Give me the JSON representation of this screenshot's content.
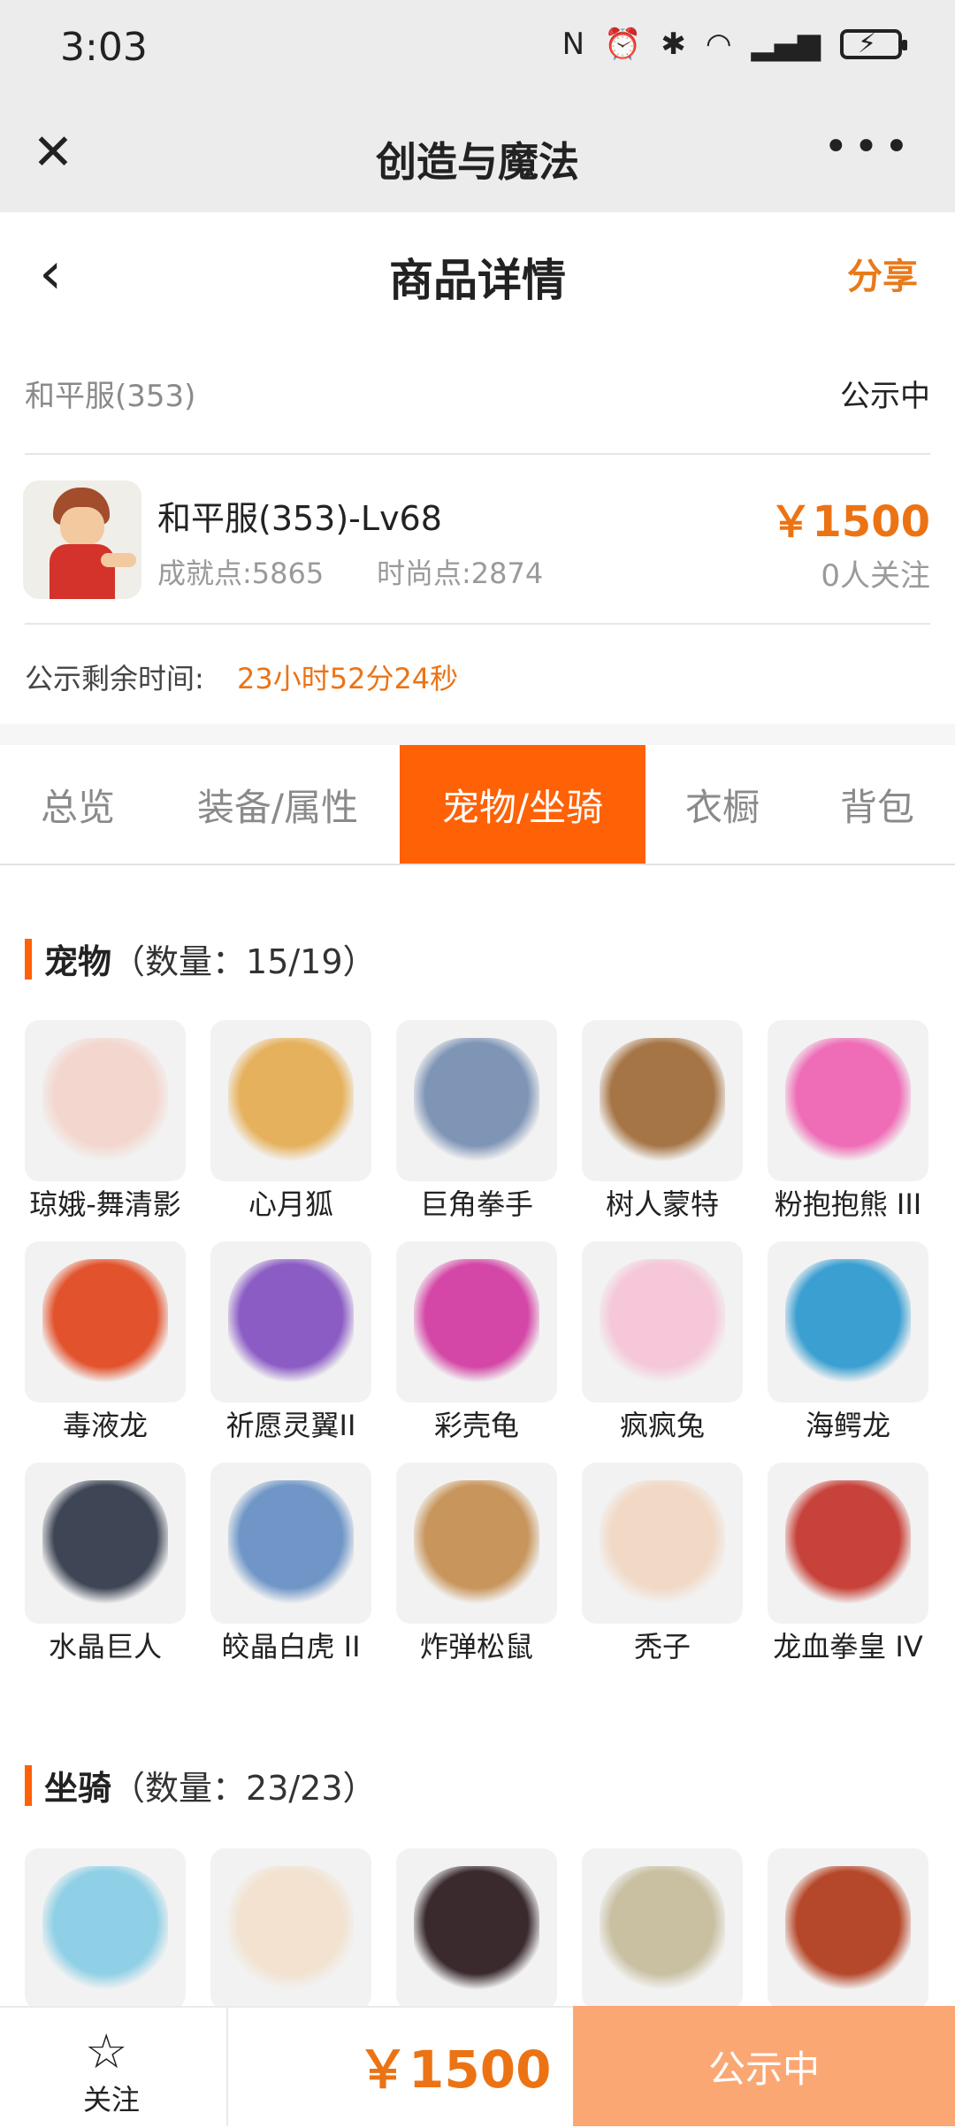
{
  "status_bar": {
    "time": "3:03"
  },
  "app_bar": {
    "title": "创造与魔法",
    "close": "✕",
    "more": "•••"
  },
  "header": {
    "back": "‹",
    "title": "商品详情",
    "share": "分享"
  },
  "listing": {
    "server": "和平服(353)",
    "state": "公示中",
    "role_name": "和平服(353)-Lv68",
    "achievement": "成就点:5865",
    "fashion": "时尚点:2874",
    "price": "￥1500",
    "followers": "0人关注",
    "remain_label": "公示剩余时间:",
    "remain_value": "23小时52分24秒"
  },
  "tabs": [
    {
      "label": "总览"
    },
    {
      "label": "装备/属性"
    },
    {
      "label": "宠物/坐骑"
    },
    {
      "label": "衣橱"
    },
    {
      "label": "背包"
    }
  ],
  "pets": {
    "title": "宠物",
    "count": "（数量：15/19）",
    "items": [
      {
        "name": "琼娥-舞清影",
        "color": "#f3d7cf"
      },
      {
        "name": "心月狐",
        "color": "#e6b15c"
      },
      {
        "name": "巨角拳手",
        "color": "#7f95b6"
      },
      {
        "name": "树人蒙特",
        "color": "#a67546"
      },
      {
        "name": "粉抱抱熊 III",
        "color": "#ef6db6"
      },
      {
        "name": "毒液龙",
        "color": "#e2522c"
      },
      {
        "name": "祈愿灵翼II",
        "color": "#8a5cc4"
      },
      {
        "name": "彩壳龟",
        "color": "#d447a6"
      },
      {
        "name": "疯疯兔",
        "color": "#f5c7d8"
      },
      {
        "name": "海鳄龙",
        "color": "#3b9fd1"
      },
      {
        "name": "水晶巨人",
        "color": "#3e4656"
      },
      {
        "name": "皎晶白虎 II",
        "color": "#6f96c7"
      },
      {
        "name": "炸弹松鼠",
        "color": "#c8955c"
      },
      {
        "name": "秃子",
        "color": "#f1d9c6"
      },
      {
        "name": "龙血拳皇 IV",
        "color": "#c7423a"
      }
    ]
  },
  "mounts": {
    "title": "坐骑",
    "count": "（数量：23/23）",
    "items": [
      {
        "name": "",
        "color": "#8fd0e6"
      },
      {
        "name": "",
        "color": "#f2e2cf"
      },
      {
        "name": "",
        "color": "#3a2a2e"
      },
      {
        "name": "",
        "color": "#c9c0a2"
      },
      {
        "name": "",
        "color": "#b5482a"
      }
    ]
  },
  "bottom": {
    "fav_label": "关注",
    "price": "￥1500",
    "button": "公示中"
  }
}
